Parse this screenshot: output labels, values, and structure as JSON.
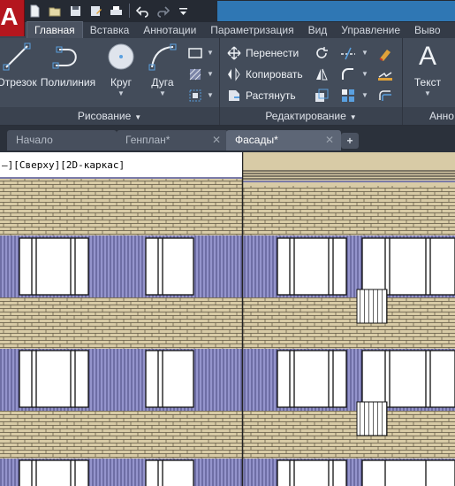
{
  "app": {
    "logo": "A"
  },
  "quick_access": [
    {
      "name": "new-icon"
    },
    {
      "name": "open-icon"
    },
    {
      "name": "save-icon"
    },
    {
      "name": "save-as-icon"
    },
    {
      "name": "print-icon"
    },
    {
      "name": "undo-icon"
    },
    {
      "name": "redo-icon"
    },
    {
      "name": "customize-dropdown-icon"
    }
  ],
  "ribbon_tabs": [
    "Главная",
    "Вставка",
    "Аннотации",
    "Параметризация",
    "Вид",
    "Управление",
    "Выво"
  ],
  "ribbon": {
    "draw_panel": {
      "title": "Рисование",
      "tools": [
        "Отрезок",
        "Полилиния",
        "Круг",
        "Дуга"
      ]
    },
    "modify_panel": {
      "title": "Редактирование",
      "tools": [
        "Перенести",
        "Копировать",
        "Растянуть"
      ]
    },
    "annotation_panel": {
      "title": "Анно",
      "tools": [
        "Текст"
      ]
    }
  },
  "doc_tabs": [
    {
      "label": "Начало",
      "active": false,
      "closable": false
    },
    {
      "label": "Генплан*",
      "active": false,
      "closable": true
    },
    {
      "label": "Фасады*",
      "active": true,
      "closable": true
    }
  ],
  "new_tab_label": "+",
  "viewport": {
    "label": "–][Сверху][2D-каркас]"
  },
  "colors": {
    "accent": "#2f77b4",
    "brand": "#b4161e",
    "brick": "#d8cba6",
    "facade_stripe": "#8e8ec8"
  }
}
